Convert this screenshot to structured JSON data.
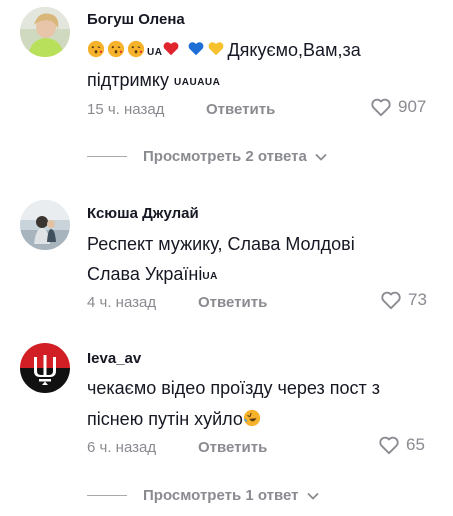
{
  "comments": [
    {
      "author": "Богуш Олена",
      "text_line1": "Дякуємо,Вам,за",
      "text_line2": "підтримку",
      "flag_line2": "UAUAUA",
      "flag_inline": "UA",
      "time": "15 ч. назад",
      "reply_label": "Ответить",
      "likes": "907",
      "replies_label": "Просмотреть 2 ответа"
    },
    {
      "author": "Ксюша Джулай",
      "text_line1": "Респект мужику, Слава Молдові",
      "text_line2": "Слава Україні",
      "flag_line2": "UA",
      "time": "4 ч. назад",
      "reply_label": "Ответить",
      "likes": "73"
    },
    {
      "author": "Ieva_av",
      "text_line1": "чекаємо відео проїзду через пост з",
      "text_line2": "піснею путін хуйло",
      "time": "6 ч. назад",
      "reply_label": "Ответить",
      "likes": "65",
      "replies_label": "Просмотреть 1 ответ"
    }
  ],
  "icons": {
    "like": "heart-outline-icon",
    "chevron": "chevron-down-icon",
    "emoji_kiss": "kissing-heart-emoji",
    "emoji_laugh": "rolling-laughing-emoji"
  },
  "colors": {
    "text": "#161823",
    "muted": "#8a8b91",
    "red_heart": "#e0242e",
    "blue_heart": "#1d6fd6",
    "yellow_heart": "#f6c22d",
    "trident_bg_top": "#d21f26"
  }
}
